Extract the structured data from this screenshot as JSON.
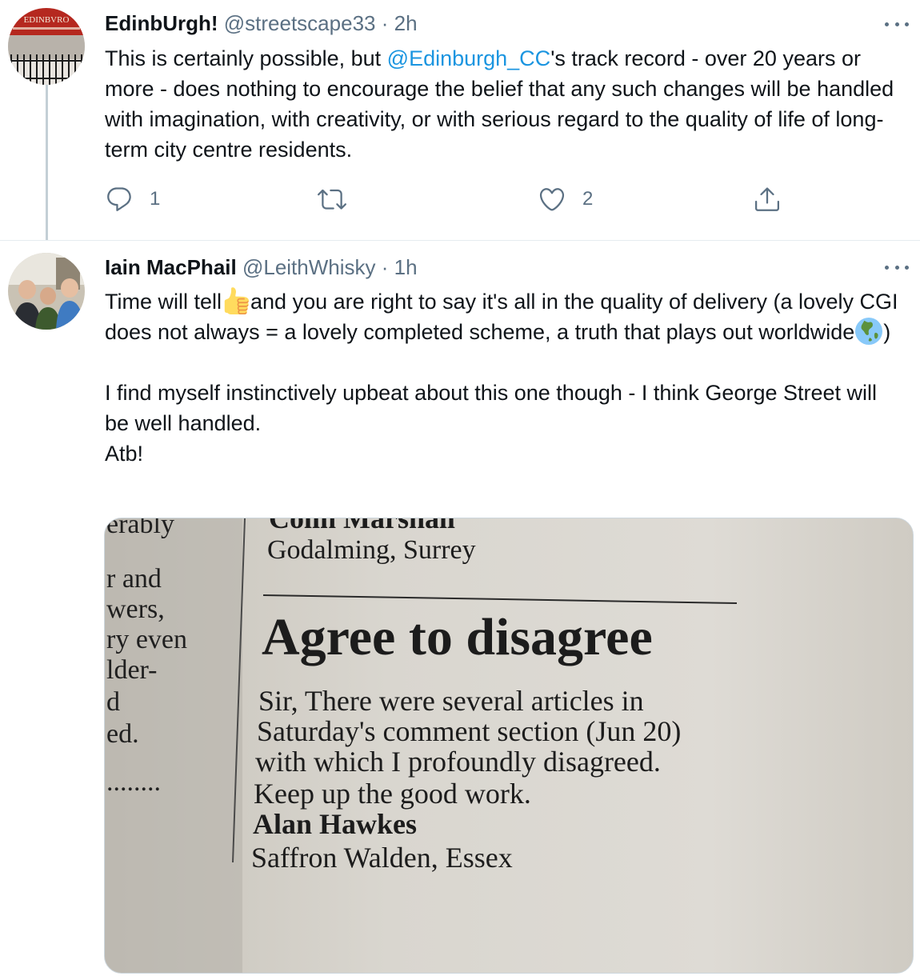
{
  "tweets": [
    {
      "author": {
        "name": "EdinbUrgh!",
        "handle": "@streetscape33",
        "separator": "·",
        "time": "2h"
      },
      "avatar_sign_text": "EDINBVRO",
      "body": {
        "before_mention": "This is certainly possible, but ",
        "mention": "@Edinburgh_CC",
        "after_mention": "'s track record - over 20 years or more - does nothing to encourage the belief that any such changes will be handled with imagination, with creativity, or with serious regard to the quality of life of long-term city centre residents."
      },
      "actions": {
        "reply_count": "1",
        "retweet_count": "",
        "like_count": "2"
      }
    },
    {
      "author": {
        "name": "Iain MacPhail",
        "handle": "@LeithWhisky",
        "separator": "·",
        "time": "1h"
      },
      "body": {
        "p1_a": "Time will tell",
        "p1_b": "and you are right to say it's all in the quality of delivery (a lovely CGI does not always = a lovely completed scheme, a truth that plays out worldwide",
        "p1_c": ")",
        "p2": "I find myself instinctively upbeat about this one though - I think George Street will be well handled.",
        "p3": "Atb!"
      },
      "emojis": [
        "thumbs-up-icon",
        "globe-asia-icon"
      ],
      "photo": {
        "left_column": [
          "erably",
          "r and",
          "wers,",
          "ry even",
          "lder-",
          "d",
          "ed.",
          "........"
        ],
        "prev_signature": "Colin Marshall",
        "prev_location": "Godalming, Surrey",
        "headline": "Agree to disagree",
        "letter_lines": [
          "Sir, There were several articles in",
          "Saturday's comment section (Jun 20)",
          "with which I profoundly disagreed.",
          "Keep up the good work."
        ],
        "signature": "Alan Hawkes",
        "location": "Saffron Walden, Essex"
      }
    }
  ],
  "colors": {
    "link": "#1b95e0",
    "secondary_text": "#5b7083",
    "primary_text": "#0f1419",
    "divider": "#e6ecf0",
    "newsprint": "#d4d0c8"
  }
}
